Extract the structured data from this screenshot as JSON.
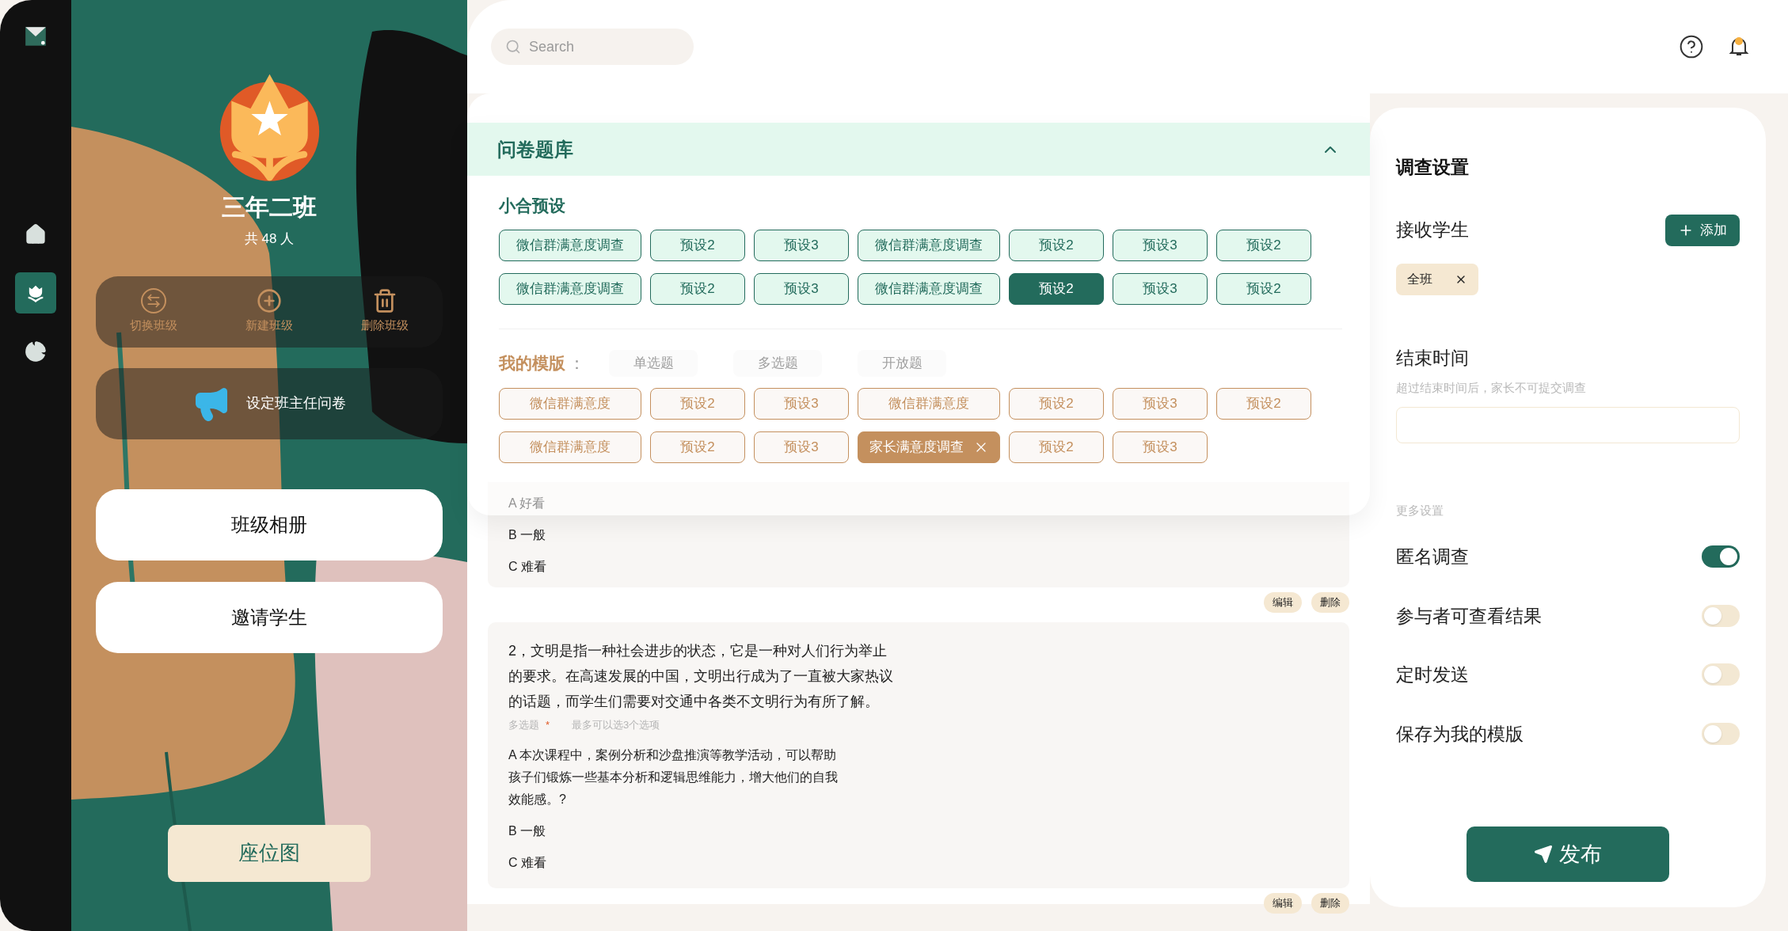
{
  "sidebar": {
    "nav": [
      {
        "kind": "home",
        "selected": false
      },
      {
        "kind": "class",
        "selected": true
      },
      {
        "kind": "stats",
        "selected": false
      }
    ]
  },
  "class_panel": {
    "name": "三年二班",
    "count": "共 48 人",
    "actions": [
      {
        "kind": "switch",
        "label": "切换班级"
      },
      {
        "kind": "add",
        "label": "新建班级"
      },
      {
        "kind": "delete",
        "label": "删除班级"
      }
    ],
    "survey_button": "设定班主任问卷",
    "links": [
      "班级相册",
      "邀请学生"
    ],
    "seat_button": "座位图"
  },
  "search": {
    "placeholder": "Search"
  },
  "question_bank": {
    "title": "问卷题库",
    "expanded": true,
    "presets": {
      "title": "小合预设",
      "chips": [
        {
          "label": "微信群满意度调查",
          "selected": false
        },
        {
          "label": "预设2",
          "selected": false
        },
        {
          "label": "预设3",
          "selected": false
        },
        {
          "label": "微信群满意度调查",
          "selected": false
        },
        {
          "label": "预设2",
          "selected": false
        },
        {
          "label": "预设3",
          "selected": false
        },
        {
          "label": "预设2",
          "selected": false
        },
        {
          "label": "微信群满意度调查",
          "selected": false
        },
        {
          "label": "预设2",
          "selected": false
        },
        {
          "label": "预设3",
          "selected": false
        },
        {
          "label": "微信群满意度调查",
          "selected": false
        },
        {
          "label": "预设2",
          "selected": true
        },
        {
          "label": "预设3",
          "selected": false
        },
        {
          "label": "预设2",
          "selected": false
        }
      ]
    },
    "templates": {
      "title": "我的模版",
      "separator": "：",
      "type_tabs": [
        "单选题",
        "多选题",
        "开放题"
      ],
      "chips": [
        {
          "label": "微信群满意度",
          "selected": false
        },
        {
          "label": "预设2",
          "selected": false
        },
        {
          "label": "预设3",
          "selected": false
        },
        {
          "label": "微信群满意度",
          "selected": false
        },
        {
          "label": "预设2",
          "selected": false
        },
        {
          "label": "预设3",
          "selected": false
        },
        {
          "label": "预设2",
          "selected": false
        },
        {
          "label": "微信群满意度",
          "selected": false
        },
        {
          "label": "预设2",
          "selected": false
        },
        {
          "label": "预设3",
          "selected": false
        },
        {
          "label": "家长满意度调查",
          "selected": true
        },
        {
          "label": "预设2",
          "selected": false
        },
        {
          "label": "预设3",
          "selected": false
        }
      ]
    }
  },
  "questions": [
    {
      "options": [
        "A 好看",
        "B 一般",
        "C 难看"
      ],
      "actions": [
        "编辑",
        "删除"
      ]
    },
    {
      "text": "2，文明是指一种社会进步的状态，它是一种对人们行为举止的要求。在高速发展的中国，文明出行成为了一直被大家热议的话题，而学生们需要对交通中各类不文明行为有所了解。",
      "type": "多选题",
      "required": "*",
      "hint": "最多可以选3个选项",
      "options": [
        "A  本次课程中，案例分析和沙盘推演等教学活动，可以帮助孩子们锻炼一些基本分析和逻辑思维能力，增大他们的自我效能感。?",
        "B 一般",
        "C 难看"
      ],
      "actions": [
        "编辑",
        "删除"
      ]
    }
  ],
  "settings": {
    "title": "调查设置",
    "recipients": {
      "label": "接收学生",
      "add_button": "添加",
      "tags": [
        "全班"
      ]
    },
    "end_time": {
      "label": "结束时间",
      "hint": "超过结束时间后，家长不可提交调查"
    },
    "more_label": "更多设置",
    "toggles": [
      {
        "label": "匿名调查",
        "on": true
      },
      {
        "label": "参与者可查看结果",
        "on": false
      },
      {
        "label": "定时发送",
        "on": false
      },
      {
        "label": "保存为我的模版",
        "on": false
      }
    ],
    "publish_button": "发布"
  }
}
